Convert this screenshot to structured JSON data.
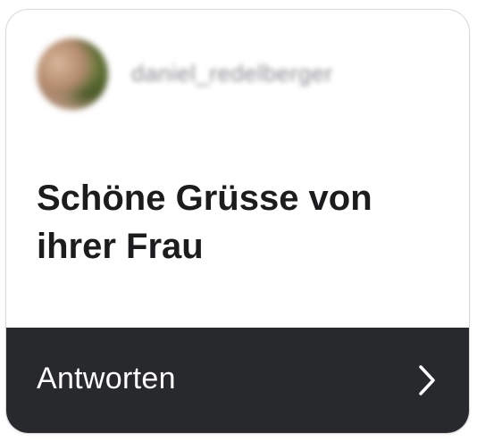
{
  "card": {
    "username": "daniel_redelberger",
    "message": "Schöne Grüsse von ihrer Frau",
    "reply_label": "Antworten",
    "icons": {
      "avatar": "user-avatar",
      "chevron": "chevron-right-icon"
    },
    "colors": {
      "reply_bar_background": "#27292d",
      "message_text": "#1c1c1e",
      "reply_text": "#ffffff",
      "username_text": "#8e8e93"
    }
  }
}
